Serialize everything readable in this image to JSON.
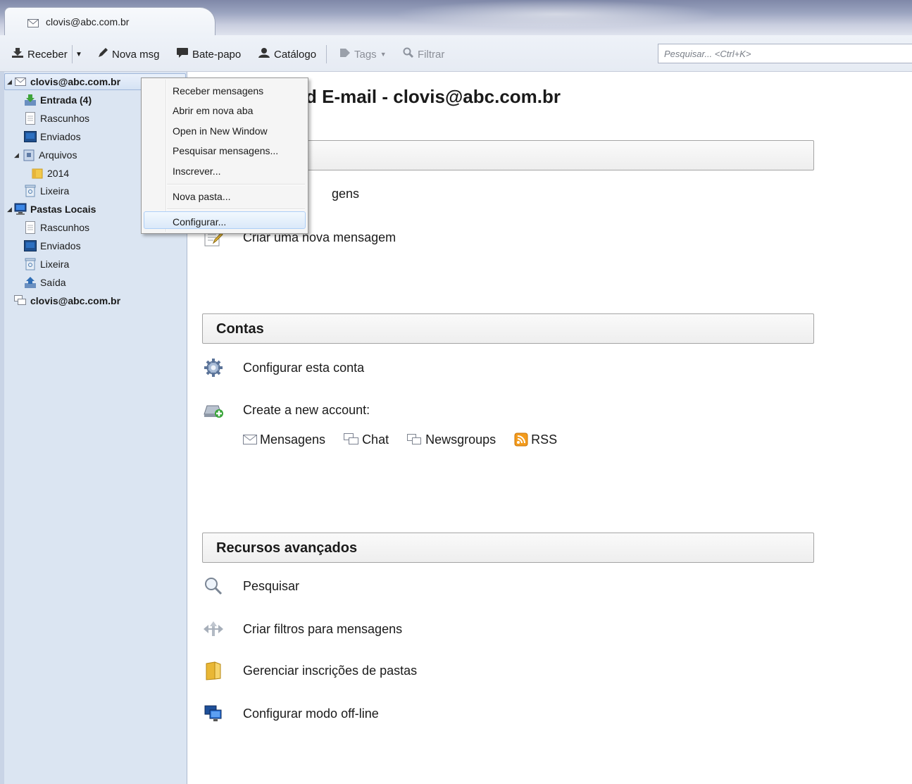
{
  "window": {
    "tab_title": "clovis@abc.com.br"
  },
  "toolbar": {
    "get_mail": "Receber",
    "write": "Nova msg",
    "chat": "Bate-papo",
    "address_book": "Catálogo",
    "tags": "Tags",
    "filter": "Filtrar",
    "search_placeholder": "Pesquisar... <Ctrl+K>"
  },
  "sidebar": {
    "account": "clovis@abc.com.br",
    "inbox": "Entrada (4)",
    "drafts": "Rascunhos",
    "sent": "Enviados",
    "archives": "Arquivos",
    "archive_2014": "2014",
    "trash": "Lixeira",
    "local_folders": "Pastas Locais",
    "local_drafts": "Rascunhos",
    "local_sent": "Enviados",
    "local_trash": "Lixeira",
    "outbox": "Saída",
    "news_account": "clovis@abc.com.br"
  },
  "context_menu": {
    "items": [
      {
        "label": "Receber mensagens"
      },
      {
        "label": "Abrir em nova aba"
      },
      {
        "label": "Open in New Window"
      },
      {
        "label": "Pesquisar mensagens..."
      },
      {
        "label": "Inscrever..."
      },
      {
        "label": "Nova pasta..."
      },
      {
        "label": "Configurar..."
      }
    ]
  },
  "main": {
    "title": "d E-mail - clovis@abc.com.br",
    "read_messages_partial": "gens",
    "compose": "Criar uma nova mensagem",
    "accounts_section": "Contas",
    "configure_account": "Configurar esta conta",
    "create_account": "Create a new account:",
    "create_links": [
      "Mensagens",
      "Chat",
      "Newsgroups",
      "RSS"
    ],
    "advanced_section": "Recursos avançados",
    "search": "Pesquisar",
    "filters": "Criar filtros para mensagens",
    "subscriptions": "Gerenciar inscrições de pastas",
    "offline": "Configurar modo off-line"
  }
}
